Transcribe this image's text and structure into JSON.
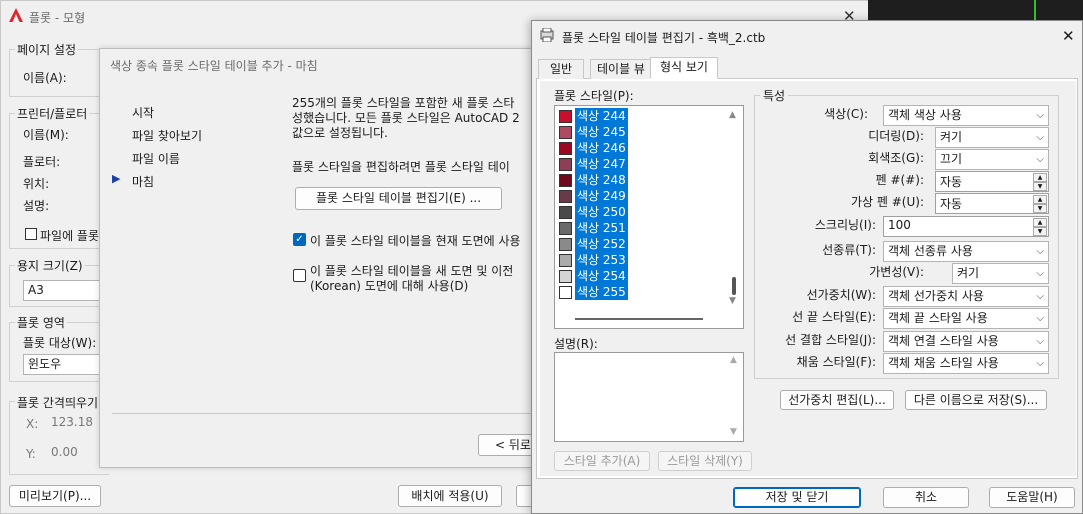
{
  "plot_dialog": {
    "title": "플롯 - 모형",
    "page_setup": {
      "group": "페이지 설정",
      "name_label": "이름(A):"
    },
    "printer": {
      "group": "프린터/플로터",
      "name_label": "이름(M):",
      "plotter_label": "플로터:",
      "location_label": "위치:",
      "description_label": "설명:",
      "plot_to_file": "파일에 플롯"
    },
    "paper_size": {
      "group": "용지 크기(Z)",
      "value": "A3"
    },
    "plot_area": {
      "group": "플롯 영역",
      "what_label": "플롯 대상(W):",
      "what_value": "윈도우"
    },
    "plot_offset": {
      "group": "플롯 간격띄우기",
      "x_label": "X:",
      "x_value": "123.18",
      "y_label": "Y:",
      "y_value": "0.00"
    },
    "preview_button": "미리보기(P)...",
    "apply_layout_button": "배치에 적용(U)"
  },
  "wizard": {
    "title": "색상 종속 플롯 스타일 테이블 추가 - 마침",
    "steps": [
      "시작",
      "파일 찾아보기",
      "파일 이름",
      "마침"
    ],
    "message_line1": "255개의 플롯 스타일을 포함한 새 플롯 스타",
    "message_line2": "성했습니다. 모든 플롯 스타일은 AutoCAD 2",
    "message_line3": "값으로 설정됩니다.",
    "edit_prompt": "플롯 스타일을 편집하려면 플롯 스타일 테이",
    "editor_button": "플롯 스타일 테이블 편집기(E) ...",
    "check_current": "이 플롯 스타일 테이블을 현재 도면에 사용",
    "check_new_line1": "이 플롯 스타일 테이블을 새 도면 및 이전",
    "check_new_line2": "(Korean) 도면에 대해 사용(D)",
    "back_button": "< 뒤로"
  },
  "editor": {
    "title": "플롯 스타일 테이블 편집기 - 흑백_2.ctb",
    "close_glyph": "✕",
    "tabs": [
      "일반",
      "테이블 뷰",
      "형식 보기"
    ],
    "styles_label": "플롯 스타일(P):",
    "styles": [
      {
        "label": "색상 244",
        "color": "#c8102e"
      },
      {
        "label": "색상 245",
        "color": "#b04a63"
      },
      {
        "label": "색상 246",
        "color": "#9b0a22"
      },
      {
        "label": "색상 247",
        "color": "#8c3f55"
      },
      {
        "label": "색상 248",
        "color": "#6e0a1c"
      },
      {
        "label": "색상 249",
        "color": "#6a3a48"
      },
      {
        "label": "색상 250",
        "color": "#4a4a4a"
      },
      {
        "label": "색상 251",
        "color": "#6a6a6a"
      },
      {
        "label": "색상 252",
        "color": "#8a8a8a"
      },
      {
        "label": "색상 253",
        "color": "#ababab"
      },
      {
        "label": "색상 254",
        "color": "#d4d4d4"
      },
      {
        "label": "색상 255",
        "color": "#ffffff"
      }
    ],
    "description_label": "설명(R):",
    "add_style_button": "스타일 추가(A)",
    "delete_style_button": "스타일 삭제(Y)",
    "properties": {
      "group": "특성",
      "color_label": "색상(C):",
      "color_value": "객체 색상 사용",
      "dither_label": "디더링(D):",
      "dither_value": "켜기",
      "grayscale_label": "회색조(G):",
      "grayscale_value": "끄기",
      "pen_label": "펜 #(#):",
      "pen_value": "자동",
      "virtual_pen_label": "가상 펜 #(U):",
      "virtual_pen_value": "자동",
      "screening_label": "스크리닝(I):",
      "screening_value": "100",
      "linetype_label": "선종류(T):",
      "linetype_value": "객체 선종류 사용",
      "adaptive_label": "가변성(V):",
      "adaptive_value": "켜기",
      "lineweight_label": "선가중치(W):",
      "lineweight_value": "객체 선가중치 사용",
      "endstyle_label": "선 끝 스타일(E):",
      "endstyle_value": "객체 끝 스타일 사용",
      "joinstyle_label": "선 결합 스타일(J):",
      "joinstyle_value": "객체 연결 스타일 사용",
      "fillstyle_label": "채움 스타일(F):",
      "fillstyle_value": "객체 채움 스타일 사용"
    },
    "edit_lineweights_button": "선가중치 편집(L)...",
    "save_as_button": "다른 이름으로 저장(S)...",
    "save_close_button": "저장 및 닫기",
    "cancel_button": "취소",
    "help_button": "도움말(H)"
  },
  "colors": {
    "accent": "#0078d7",
    "autocad_red": "#e0262b"
  }
}
